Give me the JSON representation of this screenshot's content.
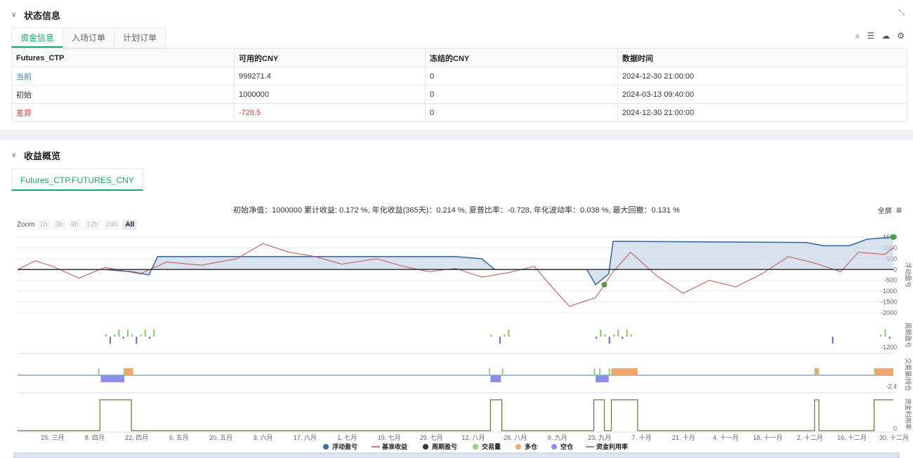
{
  "status_section": {
    "title": "状态信息",
    "tabs": [
      "资金信息",
      "入场订单",
      "计划订单"
    ],
    "table": {
      "headers": [
        "Futures_CTP",
        "可用的CNY",
        "冻结的CNY",
        "数据时间"
      ],
      "rows": [
        [
          "当前",
          "999271.4",
          "0",
          "2024-12-30 21:00:00"
        ],
        [
          "初始",
          "1000000",
          "0",
          "2024-03-13 09:40:00"
        ],
        [
          "差异",
          "-728.5",
          "0",
          "2024-12-30 21:00:00"
        ]
      ]
    }
  },
  "profit_section": {
    "title": "收益概览",
    "tab": "Futures_CTP.FUTURES_CNY",
    "summary": "初始净值：1000000 累计收益: 0.172 %, 年化收益(365天)：0.214 %, 夏普比率：-0.728, 年化波动率：0.038 %, 最大回撤：0.131 %",
    "fullscreen_label": "全屏",
    "zoom": {
      "label": "Zoom",
      "buttons": [
        "1h",
        "3h",
        "8h",
        "12h",
        "24h",
        "All"
      ],
      "active": "All"
    }
  },
  "chart_data": {
    "type": "line",
    "x_ticks": [
      "25. 三月",
      "8. 四月",
      "22. 四月",
      "6. 五月",
      "20. 五月",
      "3. 六月",
      "17. 六月",
      "1. 七月",
      "15. 七月",
      "29. 七月",
      "12. 八月",
      "26. 八月",
      "9. 九月",
      "23. 九月",
      "7. 十月",
      "21. 十月",
      "4. 十一月",
      "18. 十一月",
      "2. 十二月",
      "16. 十二月",
      "30. 十二月"
    ],
    "panes": [
      {
        "name": "浮动盈亏",
        "y_ticks": [
          "1500",
          "1000",
          "500",
          "0",
          "-500",
          "-1000",
          "-1500",
          "-2000"
        ],
        "ylim": [
          -2000,
          1500
        ]
      },
      {
        "name": "周期盈亏",
        "y_ticks": [
          "-1200"
        ]
      },
      {
        "name": "交易量/持仓",
        "y_ticks": [
          "-2.4"
        ]
      },
      {
        "name": "资金利用率",
        "y_ticks": [
          "0"
        ]
      }
    ],
    "legend": [
      {
        "name": "浮动盈亏",
        "color": "#3d6ba8",
        "kind": "dot"
      },
      {
        "name": "基准收益",
        "color": "#c0504d",
        "kind": "line"
      },
      {
        "name": "周期盈亏",
        "color": "#333333",
        "kind": "dot"
      },
      {
        "name": "交易量",
        "color": "#8fd47a",
        "kind": "dot"
      },
      {
        "name": "多仓",
        "color": "#f4a66a",
        "kind": "dot"
      },
      {
        "name": "空仓",
        "color": "#8f8fe8",
        "kind": "dot"
      },
      {
        "name": "资金利用率",
        "color": "#7a6a3a",
        "kind": "line"
      }
    ],
    "floating_pnl": [
      [
        0,
        0
      ],
      [
        0.1,
        0
      ],
      [
        0.13,
        -100
      ],
      [
        0.15,
        -250
      ],
      [
        0.16,
        600
      ],
      [
        0.2,
        600
      ],
      [
        0.3,
        600
      ],
      [
        0.5,
        600
      ],
      [
        0.53,
        500
      ],
      [
        0.545,
        0
      ],
      [
        0.6,
        0
      ],
      [
        0.65,
        0
      ],
      [
        0.66,
        -700
      ],
      [
        0.675,
        -200
      ],
      [
        0.68,
        1300
      ],
      [
        0.7,
        1300
      ],
      [
        0.9,
        1250
      ],
      [
        0.92,
        1100
      ],
      [
        0.95,
        1100
      ],
      [
        0.97,
        1400
      ],
      [
        1,
        1500
      ]
    ],
    "benchmark": [
      [
        0,
        0
      ],
      [
        0.02,
        400
      ],
      [
        0.04,
        150
      ],
      [
        0.07,
        -400
      ],
      [
        0.1,
        100
      ],
      [
        0.14,
        -200
      ],
      [
        0.17,
        350
      ],
      [
        0.21,
        200
      ],
      [
        0.25,
        500
      ],
      [
        0.28,
        1200
      ],
      [
        0.31,
        800
      ],
      [
        0.34,
        600
      ],
      [
        0.37,
        250
      ],
      [
        0.41,
        500
      ],
      [
        0.44,
        150
      ],
      [
        0.47,
        -100
      ],
      [
        0.5,
        50
      ],
      [
        0.53,
        -350
      ],
      [
        0.56,
        -150
      ],
      [
        0.59,
        150
      ],
      [
        0.61,
        -800
      ],
      [
        0.63,
        -1700
      ],
      [
        0.66,
        -1300
      ],
      [
        0.68,
        -100
      ],
      [
        0.7,
        800
      ],
      [
        0.73,
        -300
      ],
      [
        0.76,
        -1100
      ],
      [
        0.79,
        -500
      ],
      [
        0.82,
        -800
      ],
      [
        0.85,
        -200
      ],
      [
        0.88,
        600
      ],
      [
        0.91,
        300
      ],
      [
        0.94,
        -100
      ],
      [
        0.96,
        800
      ],
      [
        0.99,
        700
      ],
      [
        1,
        1000
      ]
    ]
  }
}
